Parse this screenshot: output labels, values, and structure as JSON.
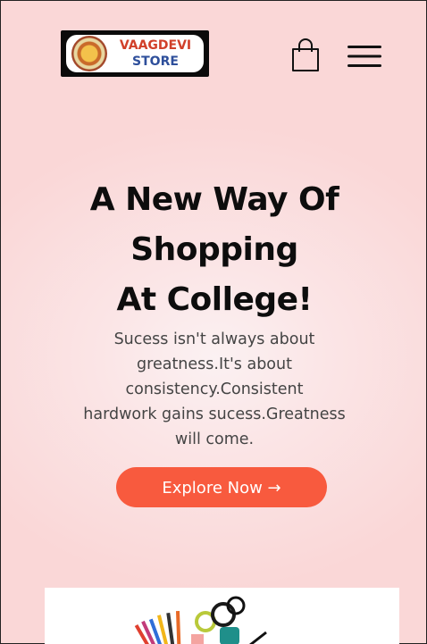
{
  "header": {
    "logo_line1": "VAAGDEVI",
    "logo_line2": "STORE",
    "cart_icon": "shopping-bag-icon",
    "menu_icon": "hamburger-menu-icon"
  },
  "hero": {
    "title_lines": [
      "A New Way Of",
      "Shopping",
      "At College!"
    ],
    "subtitle_lines": [
      "Sucess isn't always about",
      "greatness.It's about",
      "consistency.Consistent",
      "hardwork gains sucess.Greatness",
      "will come."
    ],
    "cta_label": "Explore Now →"
  },
  "colors": {
    "accent": "#f85a3e",
    "background": "#fad7d7",
    "logo_red": "#d1402a",
    "logo_blue": "#2e4f9b"
  }
}
